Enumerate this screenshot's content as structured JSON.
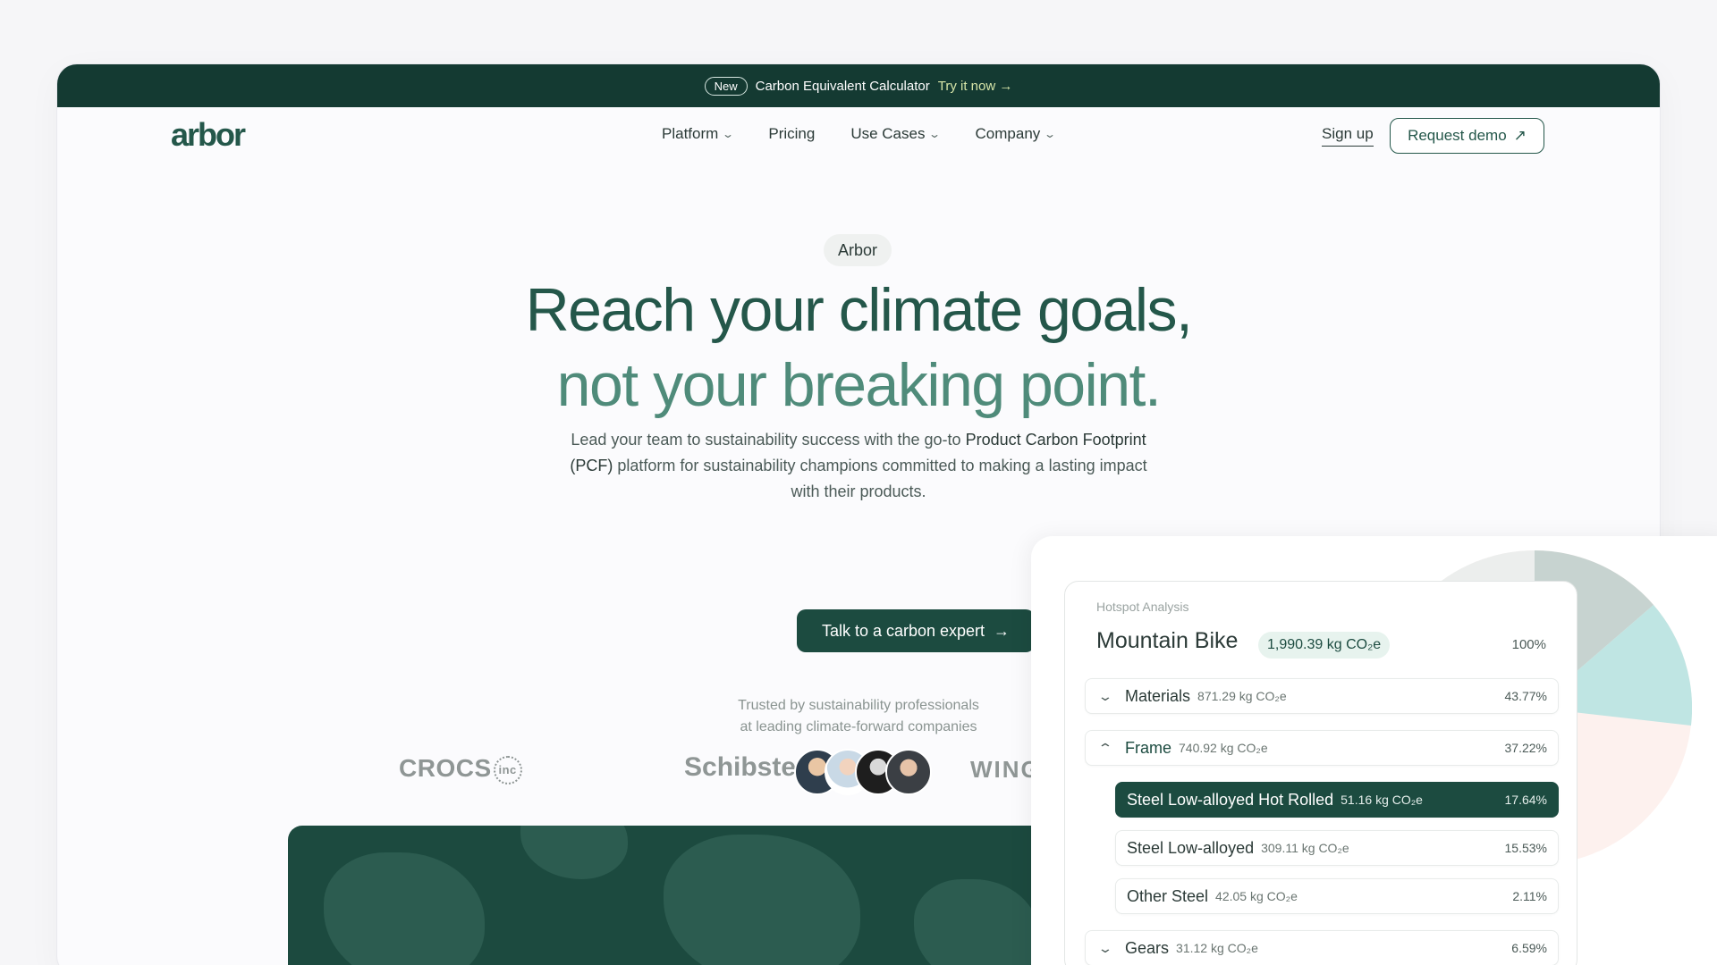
{
  "announcement": {
    "badge": "New",
    "text": "Carbon Equivalent Calculator",
    "link": "Try it now",
    "link_icon": "arrow-right"
  },
  "nav": {
    "logo": "arbor",
    "items": [
      {
        "label": "Platform",
        "dropdown": true
      },
      {
        "label": "Pricing",
        "dropdown": false
      },
      {
        "label": "Use Cases",
        "dropdown": true
      },
      {
        "label": "Company",
        "dropdown": true
      }
    ],
    "signup": "Sign up",
    "demo": "Request demo",
    "demo_icon": "arrow-up-right"
  },
  "hero": {
    "pill": "Arbor",
    "headline_1": "Reach your climate goals,",
    "headline_2": "not your breaking point.",
    "sub_1": "Lead your team to sustainability success with the go-to ",
    "sub_2": "Product Carbon Footprint (PCF)",
    "sub_3": " platform for sustainability champions committed to making a lasting impact with their products.",
    "cta": "Talk to a carbon expert",
    "cta_icon": "arrow-right",
    "trusted_1": "Trusted by sustainability professionals",
    "trusted_2": "at leading climate-forward companies"
  },
  "logos": {
    "crocs": "CROCS",
    "crocs_inc": "inc",
    "schibsted": "Schibsted",
    "wing": "WING"
  },
  "hotspot": {
    "label": "Hotspot Analysis",
    "product": "Mountain Bike",
    "total": "1,990.39 kg CO₂e",
    "total_pct": "100%",
    "rows": [
      {
        "name": "Materials",
        "value": "871.29 kg CO₂e",
        "pct": "43.77%",
        "icon": "chevron-down"
      },
      {
        "name": "Frame",
        "value": "740.92 kg CO₂e",
        "pct": "37.22%",
        "icon": "chevron-up"
      },
      {
        "name": "Steel Low-alloyed Hot Rolled",
        "value": "51.16 kg CO₂e",
        "pct": "17.64%"
      },
      {
        "name": "Steel Low-alloyed",
        "value": "309.11 kg CO₂e",
        "pct": "15.53%"
      },
      {
        "name": "Other Steel",
        "value": "42.05 kg CO₂e",
        "pct": "2.11%"
      },
      {
        "name": "Gears",
        "value": "31.12 kg CO₂e",
        "pct": "6.59%",
        "icon": "chevron-down"
      }
    ]
  },
  "colors": {
    "brand_dark": "#143a32",
    "brand": "#1c4b40",
    "accent_light": "#d6e5a8",
    "pie_teal": "#bfe5e3",
    "pie_gray": "#e4e7e6",
    "pie_peach": "#fdf1ee"
  }
}
